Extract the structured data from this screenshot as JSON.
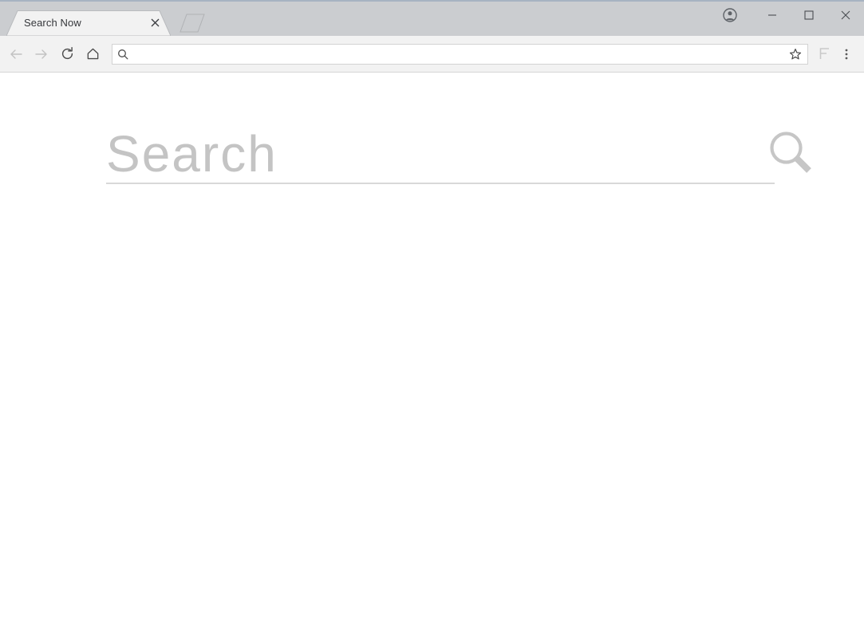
{
  "window": {
    "controls": {
      "avatar_label": "Profile",
      "minimize_label": "Minimize",
      "maximize_label": "Maximize",
      "close_label": "Close"
    }
  },
  "tabstrip": {
    "tabs": [
      {
        "title": "Search Now",
        "close_label": "Close tab",
        "active": true
      }
    ],
    "new_tab_label": "New tab"
  },
  "toolbar": {
    "back_label": "Back",
    "forward_label": "Forward",
    "reload_label": "Reload",
    "home_label": "Home",
    "bookmark_label": "Bookmark this page",
    "extension_label": "Extension",
    "menu_label": "Customize and control",
    "omnibox": {
      "value": "",
      "placeholder": "",
      "icon": "search-icon"
    }
  },
  "page": {
    "search": {
      "value": "",
      "placeholder": "Search",
      "submit_icon": "magnifier-icon"
    }
  },
  "colors": {
    "titlebar": "#cbcdd0",
    "titlebar_top_border": "#a7b3c2",
    "tab_active": "#f2f2f2",
    "toolbar": "#f2f2f2",
    "toolbar_border": "#d6d6d6",
    "page_background": "#ffffff",
    "search_placeholder": "#c4c4c4",
    "search_rule": "#d8d8d8",
    "magnifier": "#c6c6c6"
  }
}
